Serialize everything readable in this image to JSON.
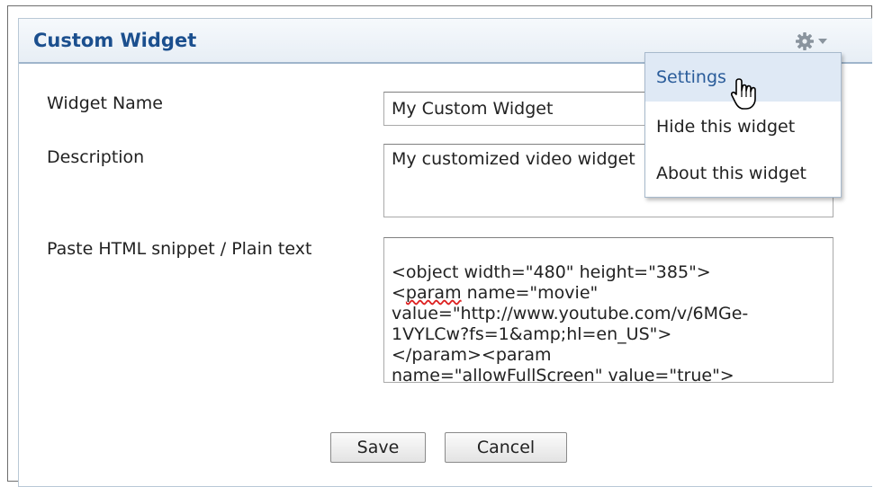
{
  "widget": {
    "title": "Custom Widget",
    "settings_menu_icon": "gear-icon"
  },
  "form": {
    "name_label": "Widget Name",
    "name_value": "My Custom Widget",
    "description_label": "Description",
    "description_value": "My customized video widget",
    "snippet_label": "Paste HTML snippet / Plain text",
    "snippet_lines": [
      "<object width=\"480\" height=\"385\">",
      "<param name=\"movie\"",
      "value=\"http://www.youtube.com/v/6MGe-",
      "1VYLCw?fs=1&amp;hl=en_US\">",
      "</param><param",
      "name=\"allowFullScreen\" value=\"true\">"
    ],
    "snippet_l1_pre": "<",
    "snippet_l1_sq": "param",
    "snippet_l1_post": " name=\"movie\"",
    "snippet_l5_pre": "name=\"",
    "snippet_l5_sq": "allowFullScreen",
    "snippet_l5_post": "\" value=\"true\">"
  },
  "buttons": {
    "save": "Save",
    "cancel": "Cancel"
  },
  "menu": {
    "items": [
      {
        "label": "Settings",
        "state": "hover"
      },
      {
        "label": "Hide this widget"
      },
      {
        "label": "About this widget"
      }
    ]
  },
  "colors": {
    "title": "#1b4f8e",
    "menu_hover_bg": "#dfe9f5",
    "menu_hover_text": "#2a5c9a"
  }
}
